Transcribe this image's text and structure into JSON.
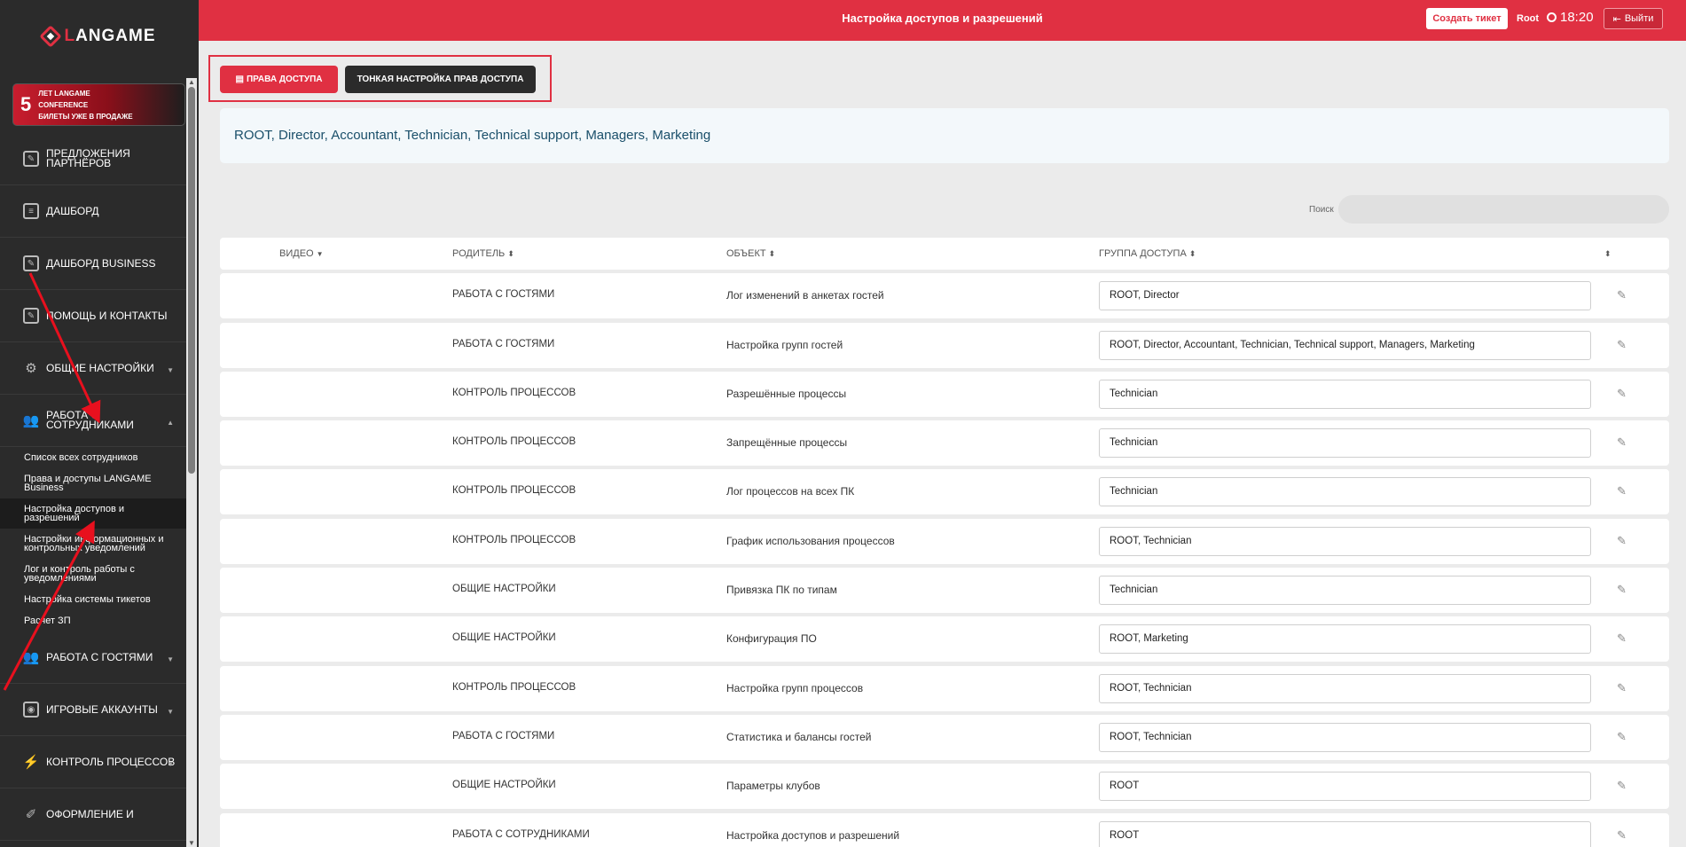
{
  "sidebar": {
    "logo_left": "L",
    "logo_right": "ANGAME",
    "promo": {
      "number": "5",
      "line1": "ЛЕТ LANGAME",
      "line2": "CONFERENCE",
      "line3": "БИЛЕТЫ УЖЕ В ПРОДАЖЕ"
    },
    "items": [
      {
        "label": "ПРЕДЛОЖЕНИЯ ПАРТНЁРОВ",
        "icon": "edit-square-icon"
      },
      {
        "label": "ДАШБОРД",
        "icon": "book-icon"
      },
      {
        "label": "ДАШБОРД BUSINESS",
        "icon": "edit-square-icon"
      },
      {
        "label": "ПОМОЩЬ И КОНТАКТЫ",
        "icon": "edit-square-icon"
      },
      {
        "label": "ОБЩИЕ НАСТРОЙКИ",
        "icon": "gear-icon"
      },
      {
        "label": "РАБОТА С СОТРУДНИКАМИ",
        "icon": "users-icon"
      }
    ],
    "subitems": [
      "Список всех сотрудников",
      "Права и доступы LANGAME Business",
      "Настройка доступов и разрешений",
      "Настройки информационных и контрольных уведомлений",
      "Лог и контроль работы с уведомлениями",
      "Настройка системы тикетов",
      "Расчет ЗП"
    ],
    "items_after": [
      {
        "label": "РАБОТА С ГОСТЯМИ",
        "icon": "users-icon"
      },
      {
        "label": "ИГРОВЫЕ АККАУНТЫ",
        "icon": "account-icon"
      },
      {
        "label": "КОНТРОЛЬ ПРОЦЕССОВ",
        "icon": "bolt-icon"
      },
      {
        "label": "ОФОРМЛЕНИЕ И",
        "icon": "brush-icon"
      }
    ]
  },
  "header": {
    "title": "Настройка доступов и разрешений",
    "create_ticket": "Создать тикет",
    "user": "Root",
    "time": "18:20",
    "logout": "Выйти"
  },
  "tabs": {
    "access_rights": "ПРАВА ДОСТУПА",
    "fine_tuning": "ТОНКАЯ НАСТРОЙКА ПРАВ ДОСТУПА"
  },
  "info_text": "ROOT, Director, Accountant, Technician, Technical support, Managers, Marketing",
  "search": {
    "label": "Поиск",
    "placeholder": ""
  },
  "table": {
    "headers": {
      "video": "ВИДЕО",
      "parent": "РОДИТЕЛЬ",
      "object": "ОБЪЕКТ",
      "group": "ГРУППА ДОСТУПА"
    },
    "rows": [
      {
        "parent": "РАБОТА С ГОСТЯМИ",
        "object": "Лог изменений в анкетах гостей",
        "group": "ROOT, Director"
      },
      {
        "parent": "РАБОТА С ГОСТЯМИ",
        "object": "Настройка групп гостей",
        "group": "ROOT, Director, Accountant, Technician, Technical support, Managers, Marketing"
      },
      {
        "parent": "КОНТРОЛЬ ПРОЦЕССОВ",
        "object": "Разрешённые процессы",
        "group": "Technician"
      },
      {
        "parent": "КОНТРОЛЬ ПРОЦЕССОВ",
        "object": "Запрещённые процессы",
        "group": "Technician"
      },
      {
        "parent": "КОНТРОЛЬ ПРОЦЕССОВ",
        "object": "Лог процессов на всех ПК",
        "group": "Technician"
      },
      {
        "parent": "КОНТРОЛЬ ПРОЦЕССОВ",
        "object": "График использования процессов",
        "group": "ROOT, Technician"
      },
      {
        "parent": "ОБЩИЕ НАСТРОЙКИ",
        "object": "Привязка ПК по типам",
        "group": "Technician"
      },
      {
        "parent": "ОБЩИЕ НАСТРОЙКИ",
        "object": "Конфигурация ПО",
        "group": "ROOT, Marketing"
      },
      {
        "parent": "КОНТРОЛЬ ПРОЦЕССОВ",
        "object": "Настройка групп процессов",
        "group": "ROOT, Technician"
      },
      {
        "parent": "РАБОТА С ГОСТЯМИ",
        "object": "Статистика и балансы гостей",
        "group": "ROOT, Technician"
      },
      {
        "parent": "ОБЩИЕ НАСТРОЙКИ",
        "object": "Параметры клубов",
        "group": "ROOT"
      },
      {
        "parent": "РАБОТА С СОТРУДНИКАМИ",
        "object": "Настройка доступов и разрешений",
        "group": "ROOT"
      }
    ]
  },
  "colors": {
    "accent": "#e03042",
    "sidebar": "#2b2b2b",
    "background": "#ebebeb"
  }
}
